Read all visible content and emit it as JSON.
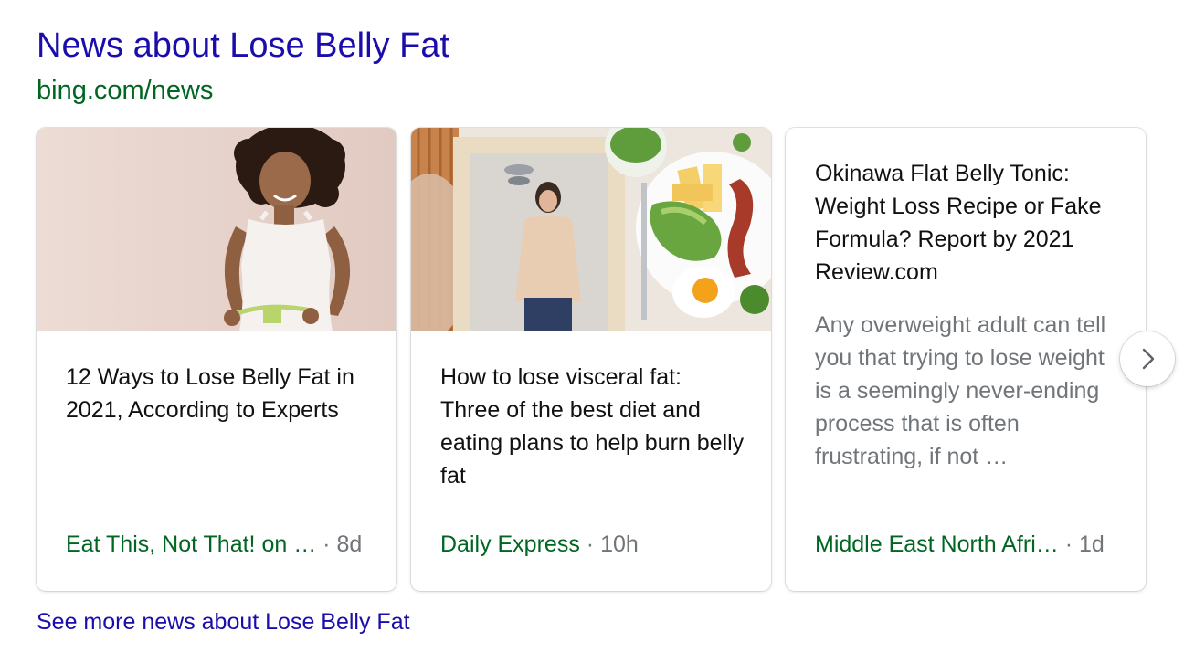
{
  "heading": "News about Lose Belly Fat",
  "source_url": "bing.com/news",
  "cards": [
    {
      "image_icon": "woman-measuring-waist-photo",
      "title": "12 Ways to Lose Belly Fat in 2021, According to Experts",
      "source": "Eat This, Not That! on …",
      "separator": "·",
      "age": "8d"
    },
    {
      "image_icon": "woman-in-mirror-with-food-plate-photo",
      "title": "How to lose visceral fat: Three of the best diet and eating plans to help burn belly fat",
      "source": "Daily Express",
      "separator": "·",
      "age": "10h"
    },
    {
      "title": "Okinawa Flat Belly Tonic: Weight Loss Recipe or Fake Formula? Report by 2021 Review.com",
      "snippet": "Any overweight adult can tell you that trying to lose weight is a seemingly never-ending process that is often frustrating, if not …",
      "source": "Middle East North Afri…",
      "separator": "·",
      "age": "1d"
    }
  ],
  "next_button_icon": "chevron-right-icon",
  "see_more": "See more news about Lose Belly Fat",
  "colors": {
    "link": "#1a0dab",
    "source_green": "#006621",
    "muted_gray": "#70757a"
  }
}
